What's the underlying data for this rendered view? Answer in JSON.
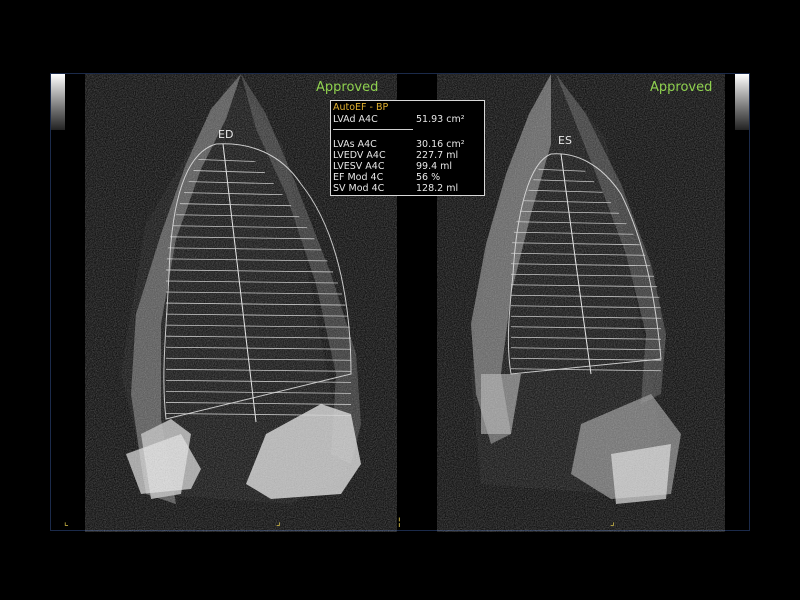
{
  "views": {
    "left": {
      "status": "Approved",
      "label": "ED"
    },
    "right": {
      "status": "Approved",
      "label": "ES"
    }
  },
  "measurements": {
    "title": "AutoEF - BP",
    "primary": {
      "name": "LVAd A4C",
      "value": "51.93 cm²"
    },
    "rows": [
      {
        "name": "LVAs A4C",
        "value": "30.16 cm²"
      },
      {
        "name": "LVEDV A4C",
        "value": "227.7 ml"
      },
      {
        "name": "LVESV A4C",
        "value": "99.4 ml"
      },
      {
        "name": "EF Mod 4C",
        "value": "56 %"
      },
      {
        "name": "SV Mod 4C",
        "value": "128.2 ml"
      }
    ]
  },
  "colors": {
    "approved": "#8fd14f",
    "title": "#e0b030",
    "tick": "#d7c04a"
  }
}
